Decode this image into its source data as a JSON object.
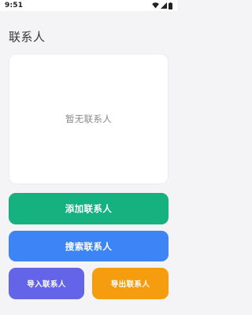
{
  "status_bar": {
    "time": "9:51",
    "icons": [
      "wifi-icon",
      "cellular-signal-icon",
      "battery-icon"
    ]
  },
  "page": {
    "title": "联系人"
  },
  "contacts": {
    "empty_text": "暂无联系人",
    "items": []
  },
  "actions": {
    "add_label": "添加联系人",
    "search_label": "搜索联系人",
    "import_label": "导入联系人",
    "export_label": "导出联系人"
  },
  "colors": {
    "background": "#f4f4f6",
    "add_button": "#15b17f",
    "search_button": "#3d85f6",
    "import_button": "#6464e8",
    "export_button": "#f59d0e"
  }
}
